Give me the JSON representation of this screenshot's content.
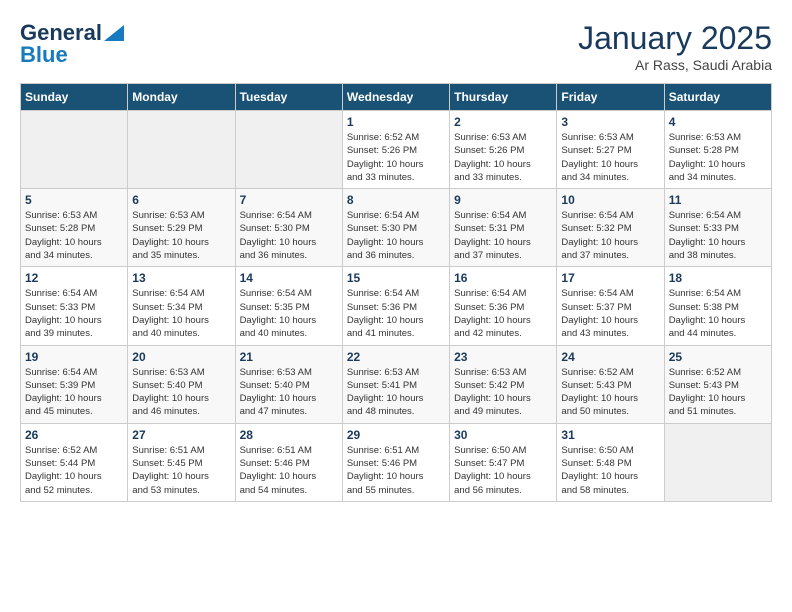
{
  "header": {
    "logo_general": "General",
    "logo_blue": "Blue",
    "month": "January 2025",
    "location": "Ar Rass, Saudi Arabia"
  },
  "weekdays": [
    "Sunday",
    "Monday",
    "Tuesday",
    "Wednesday",
    "Thursday",
    "Friday",
    "Saturday"
  ],
  "weeks": [
    [
      {
        "day": "",
        "info": ""
      },
      {
        "day": "",
        "info": ""
      },
      {
        "day": "",
        "info": ""
      },
      {
        "day": "1",
        "info": "Sunrise: 6:52 AM\nSunset: 5:26 PM\nDaylight: 10 hours\nand 33 minutes."
      },
      {
        "day": "2",
        "info": "Sunrise: 6:53 AM\nSunset: 5:26 PM\nDaylight: 10 hours\nand 33 minutes."
      },
      {
        "day": "3",
        "info": "Sunrise: 6:53 AM\nSunset: 5:27 PM\nDaylight: 10 hours\nand 34 minutes."
      },
      {
        "day": "4",
        "info": "Sunrise: 6:53 AM\nSunset: 5:28 PM\nDaylight: 10 hours\nand 34 minutes."
      }
    ],
    [
      {
        "day": "5",
        "info": "Sunrise: 6:53 AM\nSunset: 5:28 PM\nDaylight: 10 hours\nand 34 minutes."
      },
      {
        "day": "6",
        "info": "Sunrise: 6:53 AM\nSunset: 5:29 PM\nDaylight: 10 hours\nand 35 minutes."
      },
      {
        "day": "7",
        "info": "Sunrise: 6:54 AM\nSunset: 5:30 PM\nDaylight: 10 hours\nand 36 minutes."
      },
      {
        "day": "8",
        "info": "Sunrise: 6:54 AM\nSunset: 5:30 PM\nDaylight: 10 hours\nand 36 minutes."
      },
      {
        "day": "9",
        "info": "Sunrise: 6:54 AM\nSunset: 5:31 PM\nDaylight: 10 hours\nand 37 minutes."
      },
      {
        "day": "10",
        "info": "Sunrise: 6:54 AM\nSunset: 5:32 PM\nDaylight: 10 hours\nand 37 minutes."
      },
      {
        "day": "11",
        "info": "Sunrise: 6:54 AM\nSunset: 5:33 PM\nDaylight: 10 hours\nand 38 minutes."
      }
    ],
    [
      {
        "day": "12",
        "info": "Sunrise: 6:54 AM\nSunset: 5:33 PM\nDaylight: 10 hours\nand 39 minutes."
      },
      {
        "day": "13",
        "info": "Sunrise: 6:54 AM\nSunset: 5:34 PM\nDaylight: 10 hours\nand 40 minutes."
      },
      {
        "day": "14",
        "info": "Sunrise: 6:54 AM\nSunset: 5:35 PM\nDaylight: 10 hours\nand 40 minutes."
      },
      {
        "day": "15",
        "info": "Sunrise: 6:54 AM\nSunset: 5:36 PM\nDaylight: 10 hours\nand 41 minutes."
      },
      {
        "day": "16",
        "info": "Sunrise: 6:54 AM\nSunset: 5:36 PM\nDaylight: 10 hours\nand 42 minutes."
      },
      {
        "day": "17",
        "info": "Sunrise: 6:54 AM\nSunset: 5:37 PM\nDaylight: 10 hours\nand 43 minutes."
      },
      {
        "day": "18",
        "info": "Sunrise: 6:54 AM\nSunset: 5:38 PM\nDaylight: 10 hours\nand 44 minutes."
      }
    ],
    [
      {
        "day": "19",
        "info": "Sunrise: 6:54 AM\nSunset: 5:39 PM\nDaylight: 10 hours\nand 45 minutes."
      },
      {
        "day": "20",
        "info": "Sunrise: 6:53 AM\nSunset: 5:40 PM\nDaylight: 10 hours\nand 46 minutes."
      },
      {
        "day": "21",
        "info": "Sunrise: 6:53 AM\nSunset: 5:40 PM\nDaylight: 10 hours\nand 47 minutes."
      },
      {
        "day": "22",
        "info": "Sunrise: 6:53 AM\nSunset: 5:41 PM\nDaylight: 10 hours\nand 48 minutes."
      },
      {
        "day": "23",
        "info": "Sunrise: 6:53 AM\nSunset: 5:42 PM\nDaylight: 10 hours\nand 49 minutes."
      },
      {
        "day": "24",
        "info": "Sunrise: 6:52 AM\nSunset: 5:43 PM\nDaylight: 10 hours\nand 50 minutes."
      },
      {
        "day": "25",
        "info": "Sunrise: 6:52 AM\nSunset: 5:43 PM\nDaylight: 10 hours\nand 51 minutes."
      }
    ],
    [
      {
        "day": "26",
        "info": "Sunrise: 6:52 AM\nSunset: 5:44 PM\nDaylight: 10 hours\nand 52 minutes."
      },
      {
        "day": "27",
        "info": "Sunrise: 6:51 AM\nSunset: 5:45 PM\nDaylight: 10 hours\nand 53 minutes."
      },
      {
        "day": "28",
        "info": "Sunrise: 6:51 AM\nSunset: 5:46 PM\nDaylight: 10 hours\nand 54 minutes."
      },
      {
        "day": "29",
        "info": "Sunrise: 6:51 AM\nSunset: 5:46 PM\nDaylight: 10 hours\nand 55 minutes."
      },
      {
        "day": "30",
        "info": "Sunrise: 6:50 AM\nSunset: 5:47 PM\nDaylight: 10 hours\nand 56 minutes."
      },
      {
        "day": "31",
        "info": "Sunrise: 6:50 AM\nSunset: 5:48 PM\nDaylight: 10 hours\nand 58 minutes."
      },
      {
        "day": "",
        "info": ""
      }
    ]
  ]
}
